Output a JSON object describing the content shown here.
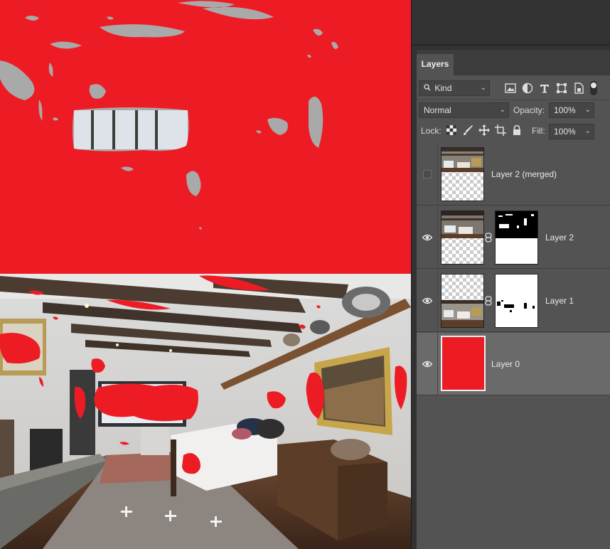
{
  "canvas": {
    "document": "bedroom-photo-with-red-layer-and-masks",
    "red_color": "#ed1c24"
  },
  "layers_panel": {
    "tab_label": "Layers",
    "filter": {
      "icon": "search-icon",
      "value": "Kind"
    },
    "filter_icons": [
      "image-filter-icon",
      "adjustment-filter-icon",
      "type-filter-icon",
      "shape-filter-icon",
      "smart-object-filter-icon",
      "filter-toggle-icon"
    ],
    "blend_mode": "Normal",
    "opacity_label": "Opacity:",
    "opacity_value": "100%",
    "lock_label": "Lock:",
    "lock_icons": [
      "lock-transparent-icon",
      "lock-pixels-icon",
      "lock-position-icon",
      "lock-artboard-icon",
      "lock-all-icon"
    ],
    "fill_label": "Fill:",
    "fill_value": "100%",
    "layers": [
      {
        "name": "Layer 2 (merged)",
        "visible": false,
        "selected": false,
        "has_mask": false
      },
      {
        "name": "Layer 2",
        "visible": true,
        "selected": false,
        "has_mask": true
      },
      {
        "name": "Layer 1",
        "visible": true,
        "selected": false,
        "has_mask": true
      },
      {
        "name": "Layer 0",
        "visible": true,
        "selected": true,
        "has_mask": false,
        "color": "#ed1c24"
      }
    ]
  }
}
